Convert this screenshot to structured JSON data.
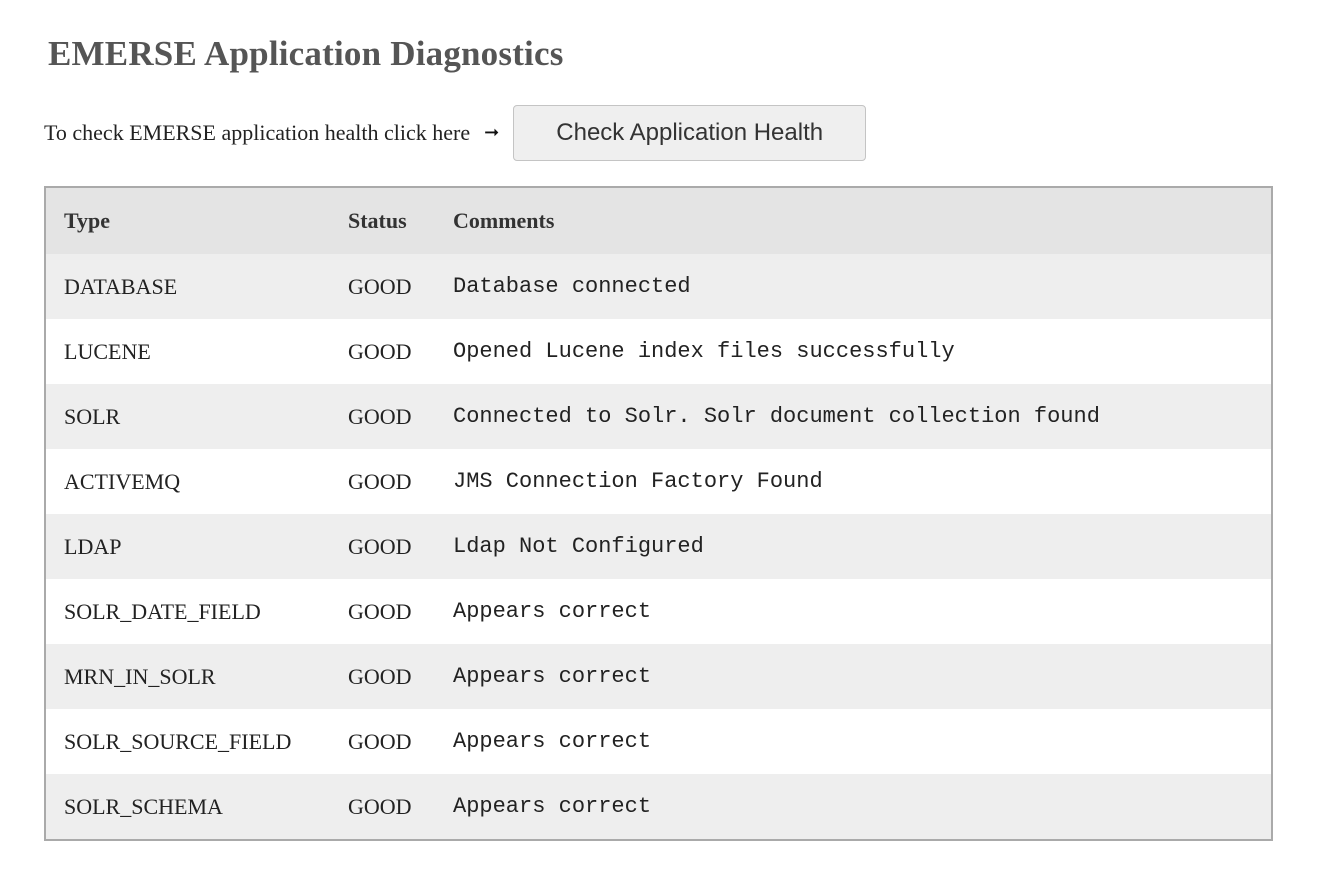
{
  "page": {
    "title": "EMERSE Application Diagnostics"
  },
  "health": {
    "prompt": "To check EMERSE application health click here",
    "arrow_icon": "right-arrow-icon",
    "arrow_glyph": "➞",
    "button_label": "Check Application Health"
  },
  "table": {
    "headers": {
      "type": "Type",
      "status": "Status",
      "comments": "Comments"
    },
    "rows": [
      {
        "type": "DATABASE",
        "status": "GOOD",
        "comment": "Database connected"
      },
      {
        "type": "LUCENE",
        "status": "GOOD",
        "comment": "Opened Lucene index files successfully"
      },
      {
        "type": "SOLR",
        "status": "GOOD",
        "comment": "Connected to Solr. Solr document collection found"
      },
      {
        "type": "ACTIVEMQ",
        "status": "GOOD",
        "comment": "JMS Connection Factory Found"
      },
      {
        "type": "LDAP",
        "status": "GOOD",
        "comment": "Ldap Not Configured"
      },
      {
        "type": "SOLR_DATE_FIELD",
        "status": "GOOD",
        "comment": "Appears correct"
      },
      {
        "type": "MRN_IN_SOLR",
        "status": "GOOD",
        "comment": "Appears correct"
      },
      {
        "type": "SOLR_SOURCE_FIELD",
        "status": "GOOD",
        "comment": "Appears correct"
      },
      {
        "type": "SOLR_SCHEMA",
        "status": "GOOD",
        "comment": "Appears correct"
      }
    ]
  }
}
